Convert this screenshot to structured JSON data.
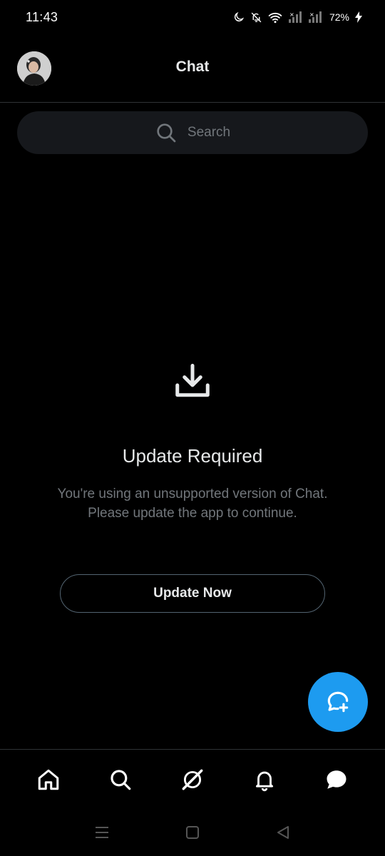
{
  "status_bar": {
    "time": "11:43",
    "battery": "72%",
    "icons": [
      "moon-icon",
      "bell-off-icon",
      "wifi-icon",
      "signal-icon",
      "signal-icon",
      "battery-charging-icon"
    ]
  },
  "header": {
    "title": "Chat",
    "avatar_icon": "profile-avatar"
  },
  "search": {
    "placeholder": "Search",
    "icon": "search-icon"
  },
  "empty_state": {
    "icon": "download-icon",
    "title": "Update Required",
    "description": "You're using an unsupported version of Chat. Please update the app to continue.",
    "button_label": "Update Now"
  },
  "fab": {
    "icon": "new-message-icon",
    "color": "#1d9bf0"
  },
  "bottom_nav": {
    "items": [
      {
        "name": "home",
        "icon": "home-icon"
      },
      {
        "name": "search",
        "icon": "search-icon"
      },
      {
        "name": "grok",
        "icon": "grok-icon"
      },
      {
        "name": "notifications",
        "icon": "bell-icon"
      },
      {
        "name": "messages",
        "icon": "chat-bubble-icon",
        "active": true
      }
    ]
  },
  "system_nav": {
    "items": [
      "recents-icon",
      "home-square-icon",
      "back-icon"
    ]
  },
  "colors": {
    "background": "#000000",
    "text_primary": "#e7e9ea",
    "text_secondary": "#71767b",
    "accent": "#1d9bf0",
    "border": "#2f3336"
  }
}
